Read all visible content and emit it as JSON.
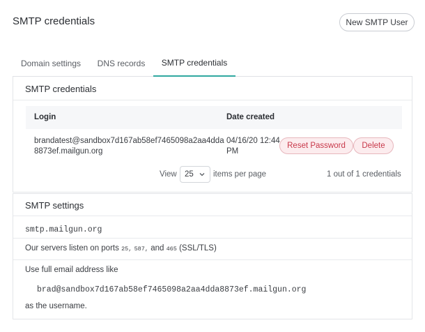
{
  "header": {
    "title": "SMTP credentials",
    "new_user_label": "New SMTP User"
  },
  "tabs": [
    {
      "label": "Domain settings",
      "active": false
    },
    {
      "label": "DNS records",
      "active": false
    },
    {
      "label": "SMTP credentials",
      "active": true
    }
  ],
  "credentials": {
    "title": "SMTP credentials",
    "columns": {
      "login": "Login",
      "date": "Date created"
    },
    "rows": [
      {
        "login": "brandatest@sandbox7d167ab58ef7465098a2aa4dda8873ef.mailgun.org",
        "date": "04/16/20 12:44 PM",
        "reset_label": "Reset Password",
        "delete_label": "Delete"
      }
    ],
    "pager": {
      "view_label": "View",
      "per_page": "25",
      "per_page_label": "items per page",
      "count_text": "1 out of 1 credentials"
    }
  },
  "settings": {
    "title": "SMTP settings",
    "host": "smtp.mailgun.org",
    "ports_prefix": "Our servers listen on ports",
    "port1": "25,",
    "port2": "587,",
    "ports_and": "and",
    "port3": "465",
    "ports_suffix": "(SSL/TLS)",
    "email_hint": "Use full email address like",
    "email_example": "brad@sandbox7d167ab58ef7465098a2aa4dda8873ef.mailgun.org",
    "username_suffix": "as the username."
  },
  "colors": {
    "accent": "#2fa8a0",
    "danger_text": "#c8384a",
    "danger_bg": "#fcecee"
  }
}
